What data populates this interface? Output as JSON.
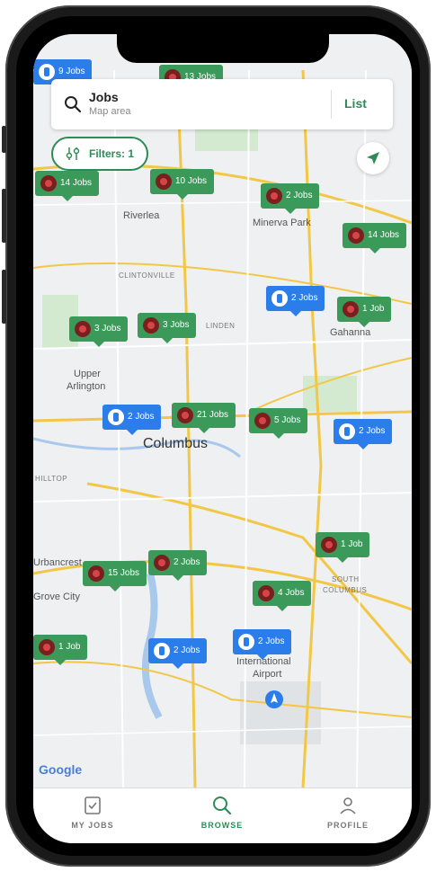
{
  "search": {
    "title": "Jobs",
    "subtitle": "Map area",
    "list_label": "List"
  },
  "filters": {
    "label": "Filters: 1"
  },
  "map": {
    "labels": [
      "Riverlea",
      "Minerva Park",
      "CLINTONVILLE",
      "LINDEN",
      "Gahanna",
      "Upper",
      "Arlington",
      "Columbus",
      "HILLTOP",
      "Urbancrest",
      "Grove City",
      "SOUTH",
      "COLUMBUS",
      "International",
      "Airport",
      "Google"
    ]
  },
  "pins": [
    {
      "label": "9 Jobs",
      "kind": "blue"
    },
    {
      "label": "13 Jobs",
      "kind": "green"
    },
    {
      "label": "14 Jobs",
      "kind": "green"
    },
    {
      "label": "10 Jobs",
      "kind": "green"
    },
    {
      "label": "2 Jobs",
      "kind": "green"
    },
    {
      "label": "14 Jobs",
      "kind": "green"
    },
    {
      "label": "2 Jobs",
      "kind": "blue"
    },
    {
      "label": "1 Job",
      "kind": "green"
    },
    {
      "label": "3 Jobs",
      "kind": "green"
    },
    {
      "label": "3 Jobs",
      "kind": "green"
    },
    {
      "label": "2 Jobs",
      "kind": "blue"
    },
    {
      "label": "21 Jobs",
      "kind": "green"
    },
    {
      "label": "5 Jobs",
      "kind": "green"
    },
    {
      "label": "2 Jobs",
      "kind": "blue"
    },
    {
      "label": "1 Job",
      "kind": "green"
    },
    {
      "label": "15 Jobs",
      "kind": "green"
    },
    {
      "label": "2 Jobs",
      "kind": "green"
    },
    {
      "label": "4 Jobs",
      "kind": "green"
    },
    {
      "label": "1 Job",
      "kind": "green"
    },
    {
      "label": "2 Jobs",
      "kind": "blue"
    },
    {
      "label": "2 Jobs",
      "kind": "blue"
    }
  ],
  "tabs": [
    {
      "label": "MY JOBS"
    },
    {
      "label": "BROWSE"
    },
    {
      "label": "PROFILE"
    }
  ],
  "colors": {
    "accent": "#2e8b57",
    "pin_green": "#3b9a5a",
    "pin_blue": "#2b7de9"
  }
}
